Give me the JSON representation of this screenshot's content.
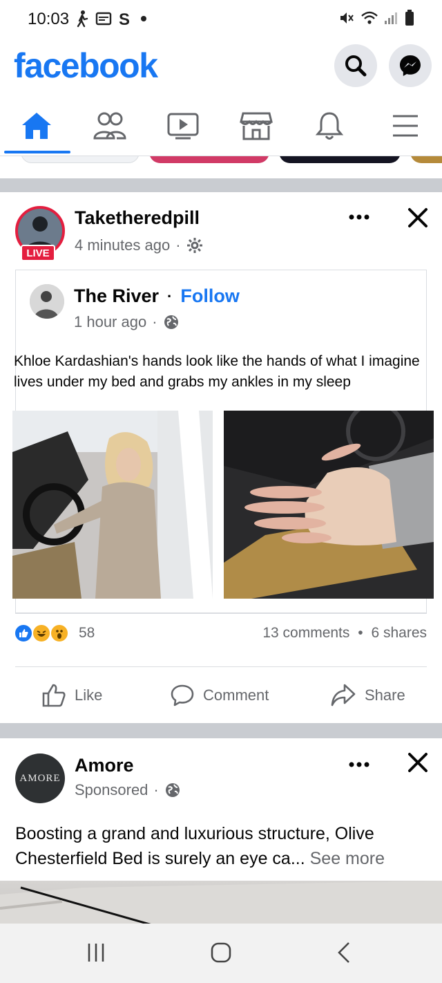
{
  "status_bar": {
    "time": "10:03",
    "left_icons": [
      "walking-icon",
      "screen-icon",
      "s-app-icon",
      "dot-icon"
    ],
    "right_icons": [
      "mute-icon",
      "wifi-icon",
      "signal-icon",
      "battery-icon"
    ]
  },
  "header": {
    "logo": "facebook",
    "brand_color": "#1877f2",
    "actions": [
      "search-icon",
      "messenger-icon"
    ]
  },
  "tabs": [
    {
      "name": "home",
      "icon": "home-icon",
      "active": true
    },
    {
      "name": "friends",
      "icon": "friends-icon",
      "active": false
    },
    {
      "name": "watch",
      "icon": "video-icon",
      "active": false
    },
    {
      "name": "marketplace",
      "icon": "store-icon",
      "active": false
    },
    {
      "name": "notifications",
      "icon": "bell-icon",
      "active": false
    },
    {
      "name": "menu",
      "icon": "hamburger-icon",
      "active": false
    }
  ],
  "post": {
    "author": "Taketheredpill",
    "live_badge": "LIVE",
    "time": "4 minutes ago",
    "sep": "·",
    "shared": {
      "author": "The River",
      "dot": "·",
      "follow": "Follow",
      "time": "1 hour ago",
      "caption": "Khloe Kardashian's hands look like the hands of what I imagine lives under my bed and grabs my ankles in my sleep"
    },
    "reactions": [
      "like",
      "haha",
      "wow"
    ],
    "reaction_count": "58",
    "comments": "13 comments",
    "shares": "6 shares",
    "stat_sep": "•",
    "actions": {
      "like": "Like",
      "comment": "Comment",
      "share": "Share"
    }
  },
  "ad": {
    "author": "Amore",
    "avatar_text": "AMORE",
    "sponsored": "Sponsored",
    "sep": "·",
    "text": "Boosting a grand and luxurious structure, Olive Chesterfield Bed is surely an eye ca...",
    "see_more": "See more"
  },
  "nav": [
    "recents-icon",
    "home-button-icon",
    "back-icon"
  ]
}
